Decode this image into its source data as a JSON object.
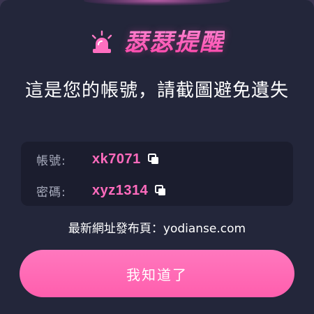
{
  "header": {
    "title": "瑟瑟提醒",
    "icon": "siren-icon"
  },
  "message": "這是您的帳號，請截圖避免遺失",
  "account": {
    "username_label": "帳號:",
    "username_value": "xk7071",
    "password_label": "密碼:",
    "password_value": "xyz1314",
    "copy_icon": "copy-icon"
  },
  "site": {
    "label": "最新網址發布頁：",
    "url": "yodianse.com"
  },
  "actions": {
    "confirm_label": "我知道了"
  },
  "colors": {
    "accent": "#ff5fb0",
    "background": "#23263a",
    "panel": "#1b1d2e",
    "value_text": "#ff6bbd"
  }
}
